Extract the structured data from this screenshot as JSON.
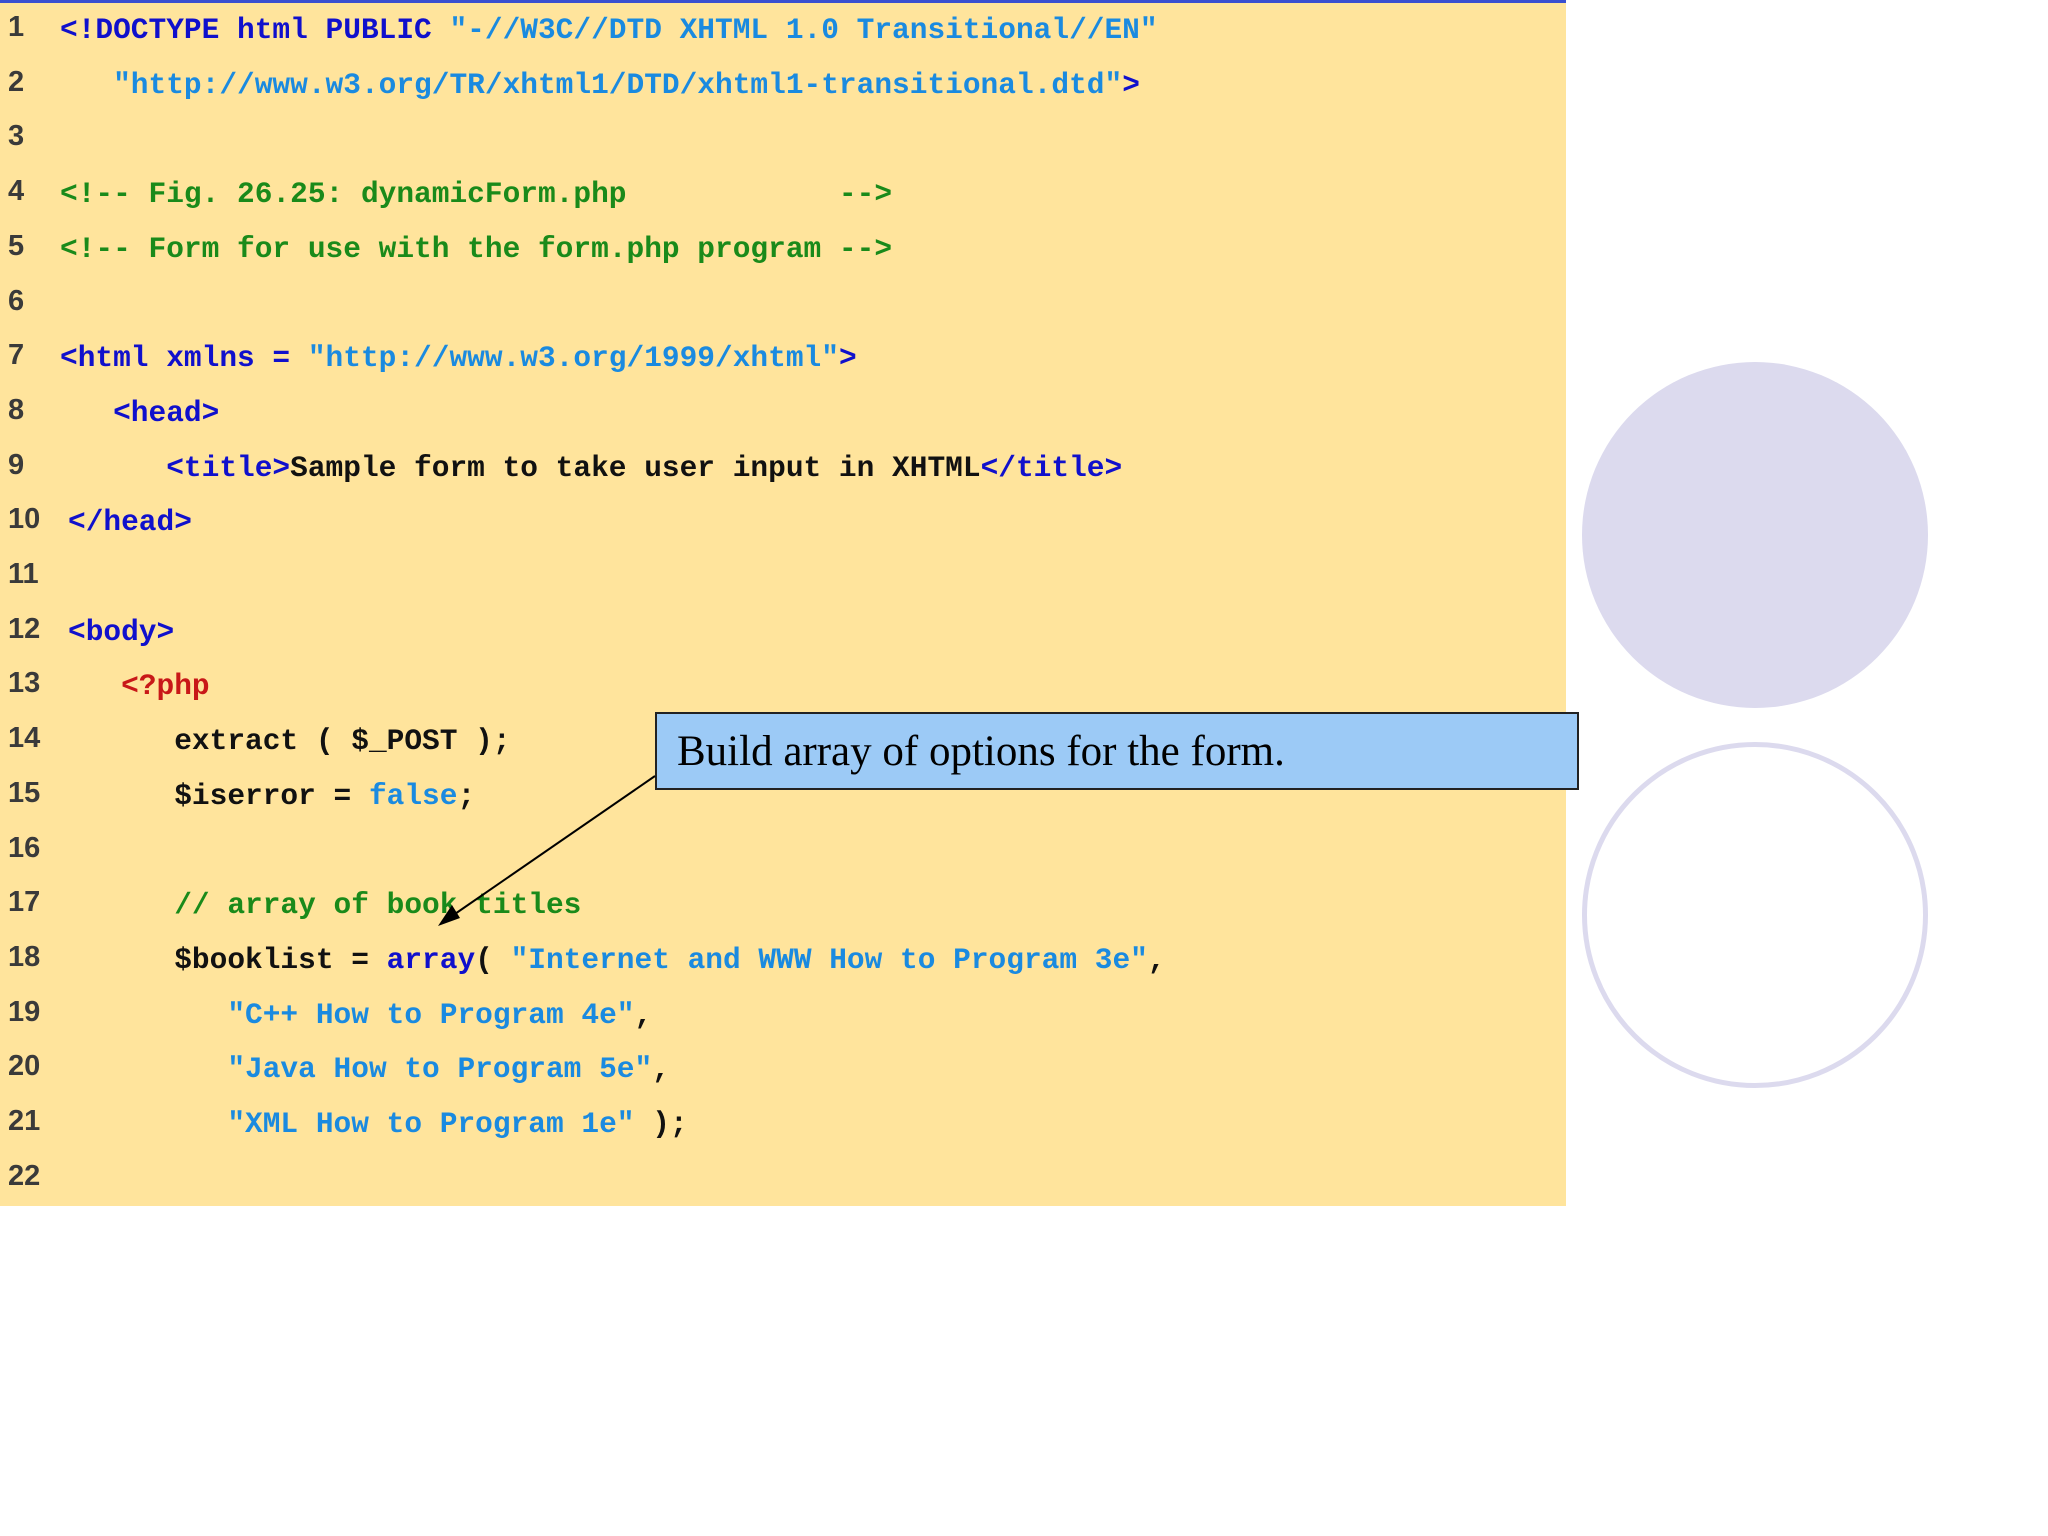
{
  "slide": {
    "code_lines": [
      {
        "num": "1",
        "tokens": [
          {
            "t": "tag",
            "s": "<!DOCTYPE html PUBLIC "
          },
          {
            "t": "str",
            "s": "\"-//W3C//DTD XHTML 1.0 Transitional//EN\""
          }
        ]
      },
      {
        "num": "2",
        "tokens": [
          {
            "t": "txt",
            "s": "   "
          },
          {
            "t": "str",
            "s": "\"http://www.w3.org/TR/xhtml1/DTD/xhtml1-transitional.dtd\""
          },
          {
            "t": "tag",
            "s": ">"
          }
        ]
      },
      {
        "num": "3",
        "tokens": []
      },
      {
        "num": "4",
        "tokens": [
          {
            "t": "cmt",
            "s": "<!-- Fig. 26.25: dynamicForm.php            -->"
          }
        ]
      },
      {
        "num": "5",
        "tokens": [
          {
            "t": "cmt",
            "s": "<!-- Form for use with the form.php program -->"
          }
        ]
      },
      {
        "num": "6",
        "tokens": []
      },
      {
        "num": "7",
        "tokens": [
          {
            "t": "tag",
            "s": "<html xmlns = "
          },
          {
            "t": "str",
            "s": "\"http://www.w3.org/1999/xhtml\""
          },
          {
            "t": "tag",
            "s": ">"
          }
        ]
      },
      {
        "num": "8",
        "tokens": [
          {
            "t": "txt",
            "s": "   "
          },
          {
            "t": "tag",
            "s": "<head>"
          }
        ]
      },
      {
        "num": "9",
        "tokens": [
          {
            "t": "txt",
            "s": "      "
          },
          {
            "t": "tag",
            "s": "<title>"
          },
          {
            "t": "txt",
            "s": "Sample form to take user input in XHTML"
          },
          {
            "t": "tag",
            "s": "</title>"
          }
        ]
      },
      {
        "num": "10",
        "tokens": [
          {
            "t": "tag",
            "s": "</head>"
          }
        ]
      },
      {
        "num": "11",
        "tokens": []
      },
      {
        "num": "12",
        "tokens": [
          {
            "t": "tag",
            "s": "<body>"
          }
        ]
      },
      {
        "num": "13",
        "tokens": [
          {
            "t": "txt",
            "s": "   "
          },
          {
            "t": "php",
            "s": "<?php"
          }
        ]
      },
      {
        "num": "14",
        "tokens": [
          {
            "t": "txt",
            "s": "      extract ( $_POST );"
          }
        ]
      },
      {
        "num": "15",
        "tokens": [
          {
            "t": "txt",
            "s": "      $iserror = "
          },
          {
            "t": "str",
            "s": "false"
          },
          {
            "t": "txt",
            "s": ";"
          }
        ]
      },
      {
        "num": "16",
        "tokens": []
      },
      {
        "num": "17",
        "tokens": [
          {
            "t": "txt",
            "s": "      "
          },
          {
            "t": "cmt",
            "s": "// array of book titles"
          }
        ]
      },
      {
        "num": "18",
        "tokens": [
          {
            "t": "txt",
            "s": "      $booklist = "
          },
          {
            "t": "tag",
            "s": "array"
          },
          {
            "t": "txt",
            "s": "( "
          },
          {
            "t": "str",
            "s": "\"Internet and WWW How to Program 3e\""
          },
          {
            "t": "txt",
            "s": ","
          }
        ]
      },
      {
        "num": "19",
        "tokens": [
          {
            "t": "txt",
            "s": "         "
          },
          {
            "t": "str",
            "s": "\"C++ How to Program 4e\""
          },
          {
            "t": "txt",
            "s": ","
          }
        ]
      },
      {
        "num": "20",
        "tokens": [
          {
            "t": "txt",
            "s": "         "
          },
          {
            "t": "str",
            "s": "\"Java How to Program 5e\""
          },
          {
            "t": "txt",
            "s": ","
          }
        ]
      },
      {
        "num": "21",
        "tokens": [
          {
            "t": "txt",
            "s": "         "
          },
          {
            "t": "str",
            "s": "\"XML How to Program 1e\""
          },
          {
            "t": "txt",
            "s": " );"
          }
        ]
      },
      {
        "num": "22",
        "tokens": []
      }
    ],
    "callout": {
      "text": "Build array of options for the form."
    },
    "colors": {
      "code_background": "#ffe49c",
      "callout_background": "#9ccaf6",
      "circle": "#dcdaee",
      "tag": "#1010cc",
      "string": "#1a8ae0",
      "comment": "#1a8a1a",
      "php": "#c81818"
    },
    "decorations": [
      "filled-circle",
      "outline-circle"
    ]
  }
}
